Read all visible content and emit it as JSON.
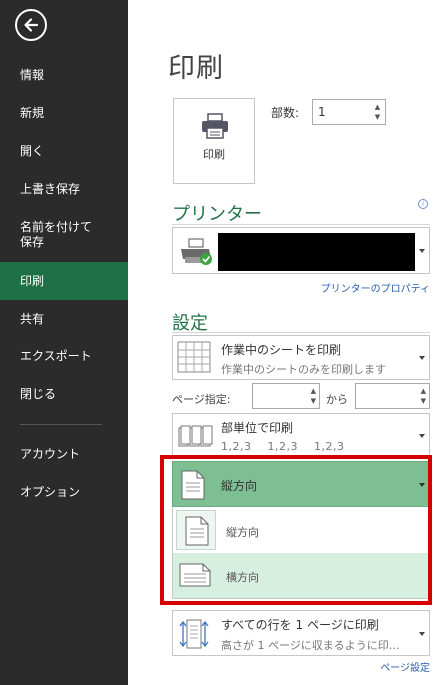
{
  "sidebar": {
    "back_icon": "arrow-left-icon",
    "items": [
      {
        "label": "情報"
      },
      {
        "label": "新規"
      },
      {
        "label": "開く"
      },
      {
        "label": "上書き保存"
      },
      {
        "label": "名前を付けて保存",
        "line1": "名前を付けて",
        "line2": "保存"
      },
      {
        "label": "印刷",
        "active": true
      },
      {
        "label": "共有"
      },
      {
        "label": "エクスポート"
      },
      {
        "label": "閉じる"
      },
      {
        "label": "アカウント"
      },
      {
        "label": "オプション"
      }
    ],
    "active_color": "#1e7145"
  },
  "main": {
    "title": "印刷",
    "print_button": {
      "label": "印刷",
      "icon": "printer-icon"
    },
    "copies": {
      "label": "部数:",
      "value": "1"
    },
    "printer": {
      "section_title": "プリンター",
      "info_icon": "info-icon",
      "name_redacted": true,
      "properties_link": "プリンターのプロパティ"
    },
    "settings": {
      "section_title": "設定",
      "print_range": {
        "main": "作業中のシートを印刷",
        "sub": "作業中のシートのみを印刷します"
      },
      "pages": {
        "label": "ページ指定:",
        "to": "から",
        "from_value": "",
        "to_value": ""
      },
      "collate": {
        "main": "部単位で印刷",
        "sub": "1,2,3    1,2,3    1,2,3"
      },
      "orientation": {
        "selected": "縦方向",
        "options": [
          {
            "label": "縦方向",
            "icon": "portrait-page-icon"
          },
          {
            "label": "横方向",
            "icon": "landscape-page-icon",
            "hovered": true
          }
        ]
      },
      "scaling": {
        "main": "すべての行を 1 ページに印刷",
        "sub": "高さが 1 ページに収まるように印…"
      },
      "page_setup_link": "ページ設定"
    }
  },
  "colors": {
    "accent": "#217346",
    "selected_bg": "#7dbf93",
    "highlight_frame": "#d40000",
    "link": "#2a5db0"
  }
}
